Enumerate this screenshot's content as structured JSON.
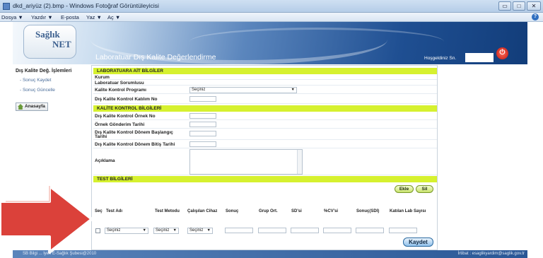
{
  "window": {
    "title": "dkd_ariyüz (2).bmp - Windows Fotoğraf Görüntüleyicisi",
    "minimize": "▭",
    "maximize": "□",
    "close": "✕"
  },
  "menu": {
    "items": [
      "Dosya ▼",
      "Yazdır ▼",
      "E-posta",
      "Yaz ▼",
      "Aç ▼"
    ]
  },
  "banner": {
    "logo_line1": "Sağlık",
    "logo_line2": "NET",
    "app_title": "Laboratuar Dış Kalite Değerlendirme",
    "welcome": "Hoşgeldiniz Sn.",
    "power_glyph": "⏻"
  },
  "sidebar": {
    "heading": "Dış Kalite Değ. İşlemleri",
    "items": [
      "- Sonuç Kaydet",
      "- Sonuç Güncelle"
    ],
    "home": "Anasayfa"
  },
  "lab": {
    "section": "LABORATUARA AİT BİLGİLER",
    "kurum": "Kurum",
    "sorumlusu": "Laboratuar Sorumlusu",
    "program": "Kalite Kontrol Programı",
    "program_value": "Seçiniz",
    "katilim_no": "Dış Kalite Kontrol Katılım No"
  },
  "kalite": {
    "section": "KALİTE KONTROL BİLGİLERİ",
    "ornek_no": "Dış Kalite Kontrol Örnek No",
    "gonderim": "Örnek Gönderim Tarihi",
    "baslangic_1": "Dış Kalite Kontrol Dönem Başlangıç",
    "baslangic_2": "Tarihi",
    "bitis": "Dış Kalite Kontrol Dönem Bitiş Tarihi",
    "aciklama": "Açıklama"
  },
  "test": {
    "section": "TEST BİLGİLERİ",
    "ekle": "Ekle",
    "sil": "Sil",
    "headers": [
      "Seç",
      "Test Adı",
      "Test Metodu",
      "Çalışılan Cihaz",
      "Sonuç",
      "Grup Ort.",
      "SD'si",
      "%CV'si",
      "Sonuç(SDI)",
      "Katılan Lab Sayısı"
    ],
    "row_test": "Seçiniz",
    "row_metod": "Seçiniz",
    "row_cihaz": "Seçiniz",
    "save": "Kaydet"
  },
  "footer": {
    "left": "SB Bilgi ... lyeri E-Sağlık Şubesi@2010",
    "right": "İrtibat : esaglikyardim@saglik.gov.tr"
  },
  "colors": {
    "section_bar": "#d6f12f",
    "banner_dark": "#123d7a",
    "arrow_red": "#d9312a"
  }
}
